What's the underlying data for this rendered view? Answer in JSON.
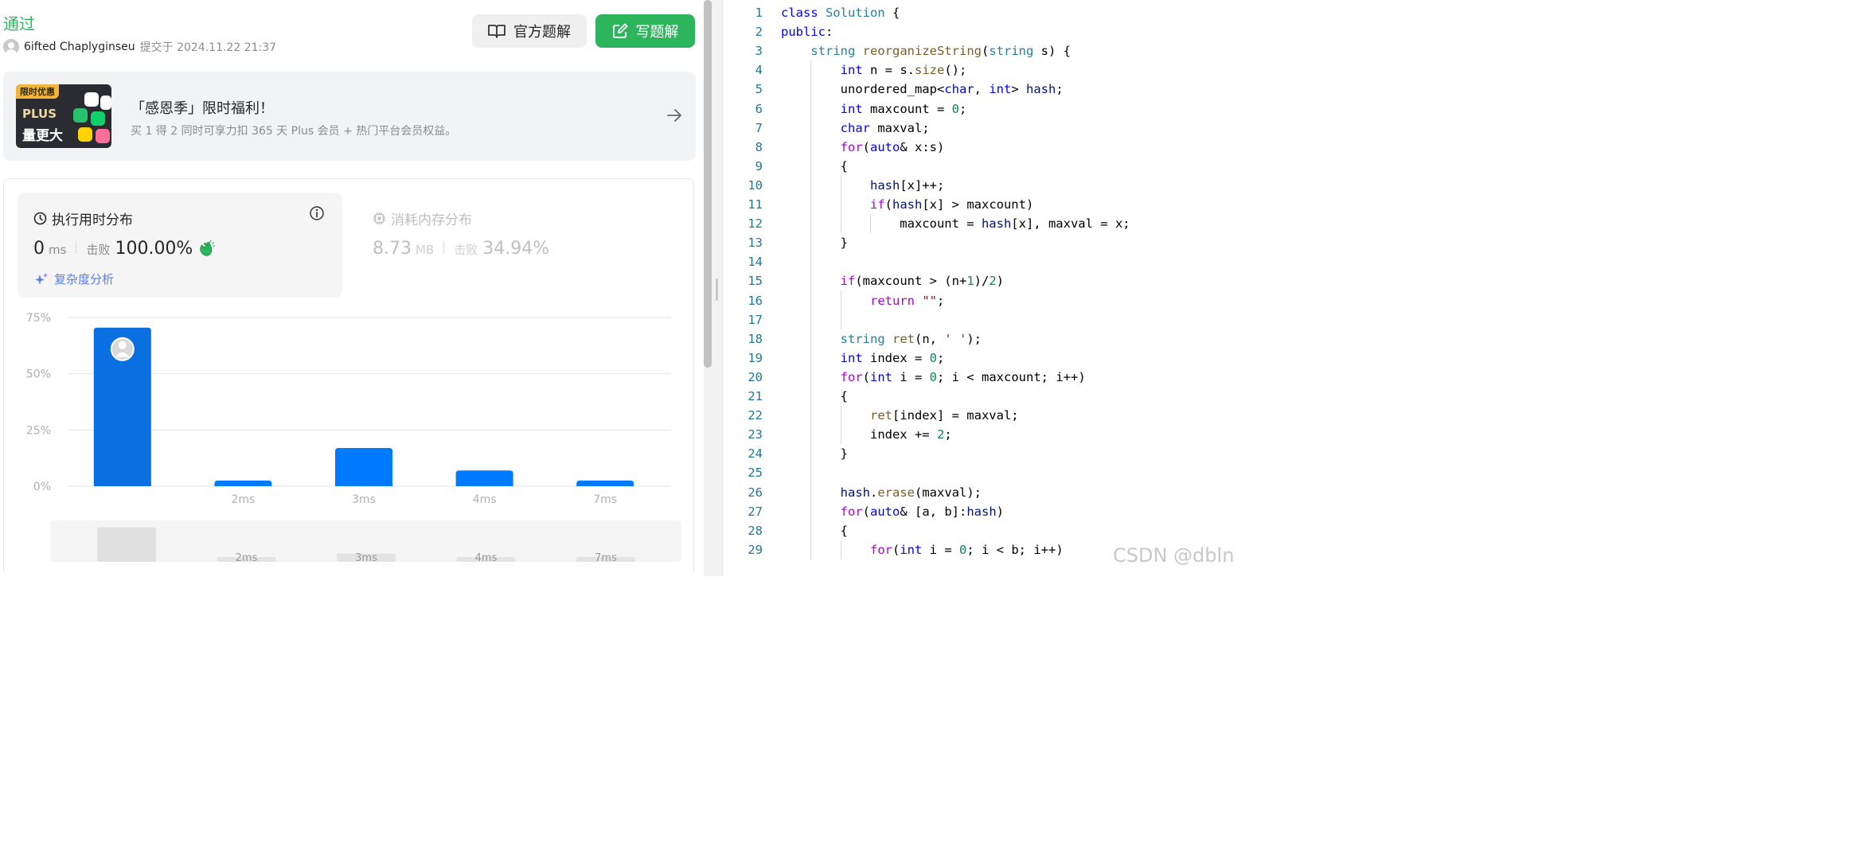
{
  "submission": {
    "status": "通过",
    "user": "6ifted Chaplyginseu",
    "submitted_label": "提交于 2024.11.22 21:37"
  },
  "buttons": {
    "official_solution": "官方题解",
    "write_solution": "写题解"
  },
  "promo": {
    "badge": "限时优惠",
    "image_plus": "PLUS",
    "image_big": "量更大",
    "title": "「感恩季」限时福利！",
    "subtitle": "买 1 得 2 同时可享力扣 365 天 Plus 会员 + 热门平台会员权益。"
  },
  "runtime": {
    "title": "执行用时分布",
    "value": "0",
    "unit": "ms",
    "beat_label": "击败",
    "beat_value": "100.00%",
    "complexity_link": "复杂度分析"
  },
  "memory": {
    "title": "消耗内存分布",
    "value": "8.73",
    "unit": "MB",
    "beat_label": "击败",
    "beat_value": "34.94%"
  },
  "chart_data": {
    "type": "bar",
    "categories": [
      "0ms",
      "2ms",
      "3ms",
      "4ms",
      "7ms"
    ],
    "category_labels": [
      "",
      "2ms",
      "3ms",
      "4ms",
      "7ms"
    ],
    "values": [
      70.5,
      2.5,
      17.0,
      7.0,
      2.5
    ],
    "ylim": [
      0,
      75
    ],
    "yticks": [
      "75%",
      "50%",
      "25%",
      "0%"
    ],
    "ytick_values": [
      75,
      50,
      25,
      0
    ],
    "grid": true,
    "bar_color": "#007aff",
    "highlight_color": "#0a6fe0"
  },
  "brush_labels": [
    "2ms",
    "3ms",
    "4ms",
    "7ms"
  ],
  "code": {
    "lines": [
      "class Solution {",
      "public:",
      "    string reorganizeString(string s) {",
      "        int n = s.size();",
      "        unordered_map<char, int> hash;",
      "        int maxcount = 0;",
      "        char maxval;",
      "        for(auto& x:s)",
      "        {",
      "            hash[x]++;",
      "            if(hash[x] > maxcount)",
      "                maxcount = hash[x], maxval = x;",
      "        }",
      "",
      "        if(maxcount > (n+1)/2)",
      "            return \"\";",
      "",
      "        string ret(n, ' ');",
      "        int index = 0;",
      "        for(int i = 0; i < maxcount; i++)",
      "        {",
      "            ret[index] = maxval;",
      "            index += 2;",
      "        }",
      "",
      "        hash.erase(maxval);",
      "        for(auto& [a, b]:hash)",
      "        {",
      "            for(int i = 0; i < b; i++)"
    ]
  },
  "watermark": "CSDN @dbln",
  "colors": {
    "accent_green": "#2db55d",
    "link_blue": "#5a7ff0",
    "bar_blue": "#007aff"
  }
}
